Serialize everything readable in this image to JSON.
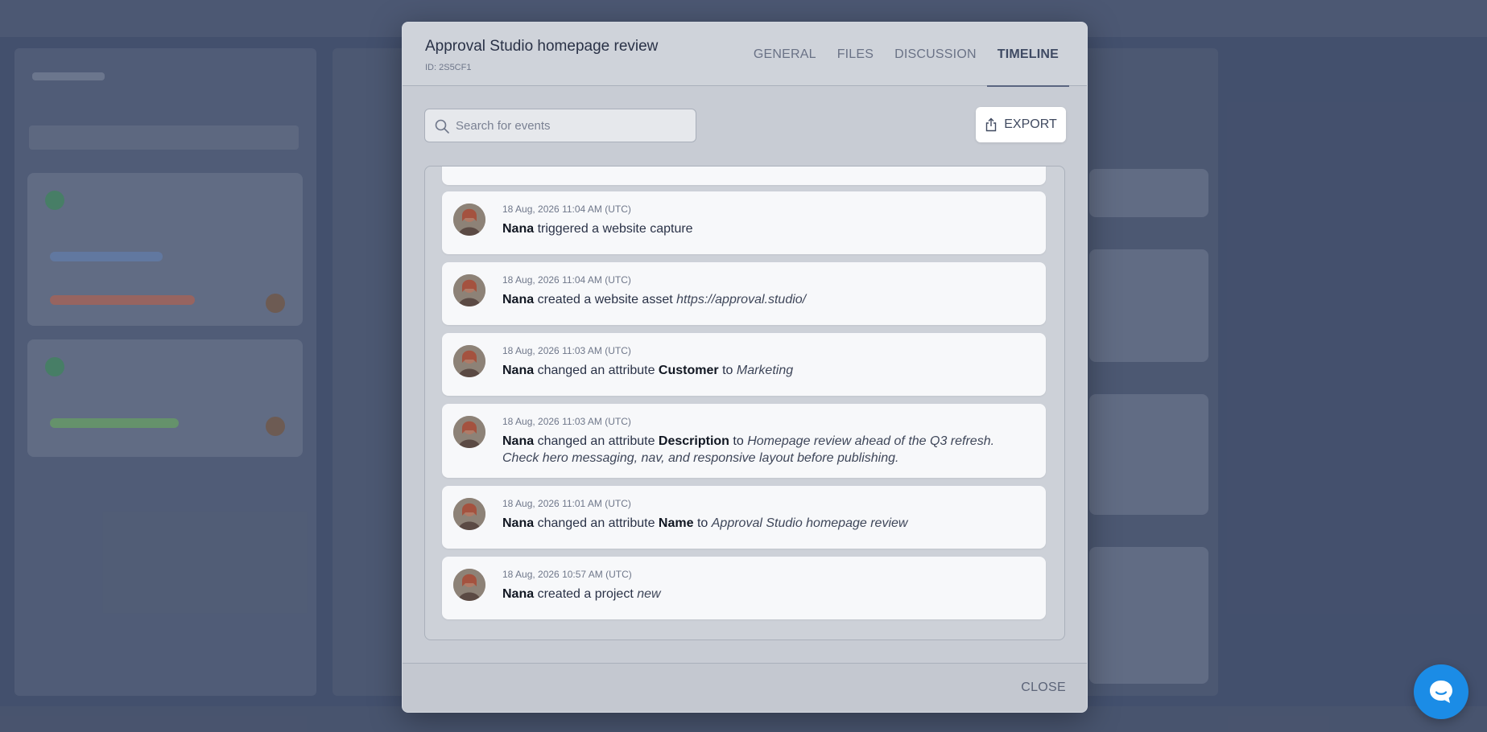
{
  "modal": {
    "title": "Approval Studio homepage review",
    "id_label": "ID: 2S5CF1",
    "tabs": [
      {
        "label": "GENERAL",
        "active": false
      },
      {
        "label": "FILES",
        "active": false
      },
      {
        "label": "DISCUSSION",
        "active": false
      },
      {
        "label": "TIMELINE",
        "active": true
      }
    ],
    "search": {
      "placeholder": "Search for events",
      "value": ""
    },
    "export_label": "EXPORT",
    "close_label": "CLOSE",
    "events": [
      {
        "time": "18 Aug, 2026 11:04 AM (UTC)",
        "user": "Nana",
        "action": "triggered a website capture",
        "attribute": "",
        "connector": "",
        "value": ""
      },
      {
        "time": "18 Aug, 2026 11:04 AM (UTC)",
        "user": "Nana",
        "action": "created a website asset",
        "attribute": "",
        "connector": "",
        "value": "https://approval.studio/"
      },
      {
        "time": "18 Aug, 2026 11:03 AM (UTC)",
        "user": "Nana",
        "action": "changed an attribute",
        "attribute": "Customer",
        "connector": "to",
        "value": "Marketing"
      },
      {
        "time": "18 Aug, 2026 11:03 AM (UTC)",
        "user": "Nana",
        "action": "changed an attribute",
        "attribute": "Description",
        "connector": "to",
        "value": "Homepage review ahead of the Q3 refresh. Check hero messaging, nav, and responsive layout before publishing."
      },
      {
        "time": "18 Aug, 2026 11:01 AM (UTC)",
        "user": "Nana",
        "action": "changed an attribute",
        "attribute": "Name",
        "connector": "to",
        "value": "Approval Studio homepage review"
      },
      {
        "time": "18 Aug, 2026 10:57 AM (UTC)",
        "user": "Nana",
        "action": "created a project",
        "attribute": "",
        "connector": "",
        "value": "new"
      }
    ]
  },
  "colors": {
    "accent": "#1b8ce6",
    "modal_bg": "#c8ccd4",
    "card_bg": "#f7f8fa",
    "text": "#2a3247"
  },
  "icons": {
    "search": "search-icon",
    "export": "share-icon",
    "chat": "chat-bubble-icon"
  }
}
